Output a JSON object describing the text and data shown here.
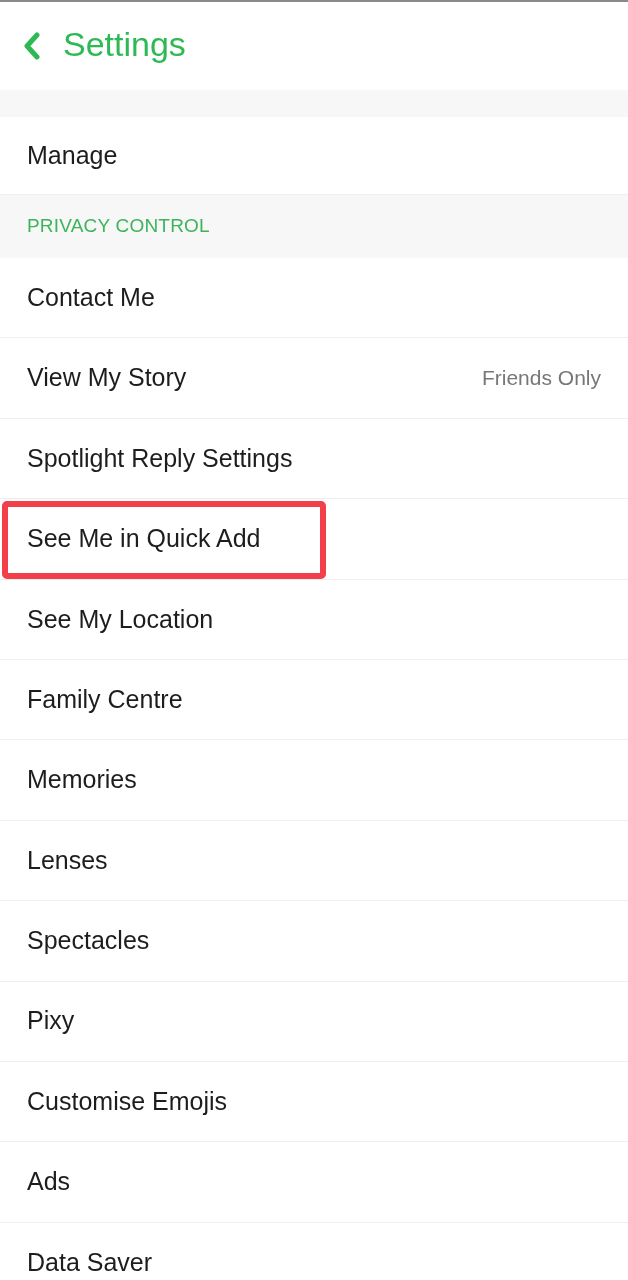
{
  "header": {
    "title": "Settings"
  },
  "sections": [
    {
      "items": [
        {
          "label": "Manage",
          "highlighted": false
        }
      ]
    },
    {
      "title": "PRIVACY CONTROL",
      "items": [
        {
          "label": "Contact Me",
          "highlighted": false
        },
        {
          "label": "View My Story",
          "value": "Friends Only",
          "highlighted": false
        },
        {
          "label": "Spotlight Reply Settings",
          "highlighted": false
        },
        {
          "label": "See Me in Quick Add",
          "highlighted": true
        },
        {
          "label": "See My Location",
          "highlighted": false
        },
        {
          "label": "Family Centre",
          "highlighted": false
        },
        {
          "label": "Memories",
          "highlighted": false
        },
        {
          "label": "Lenses",
          "highlighted": false
        },
        {
          "label": "Spectacles",
          "highlighted": false
        },
        {
          "label": "Pixy",
          "highlighted": false
        },
        {
          "label": "Customise Emojis",
          "highlighted": false
        },
        {
          "label": "Ads",
          "highlighted": false
        },
        {
          "label": "Data Saver",
          "highlighted": false
        }
      ]
    }
  ]
}
